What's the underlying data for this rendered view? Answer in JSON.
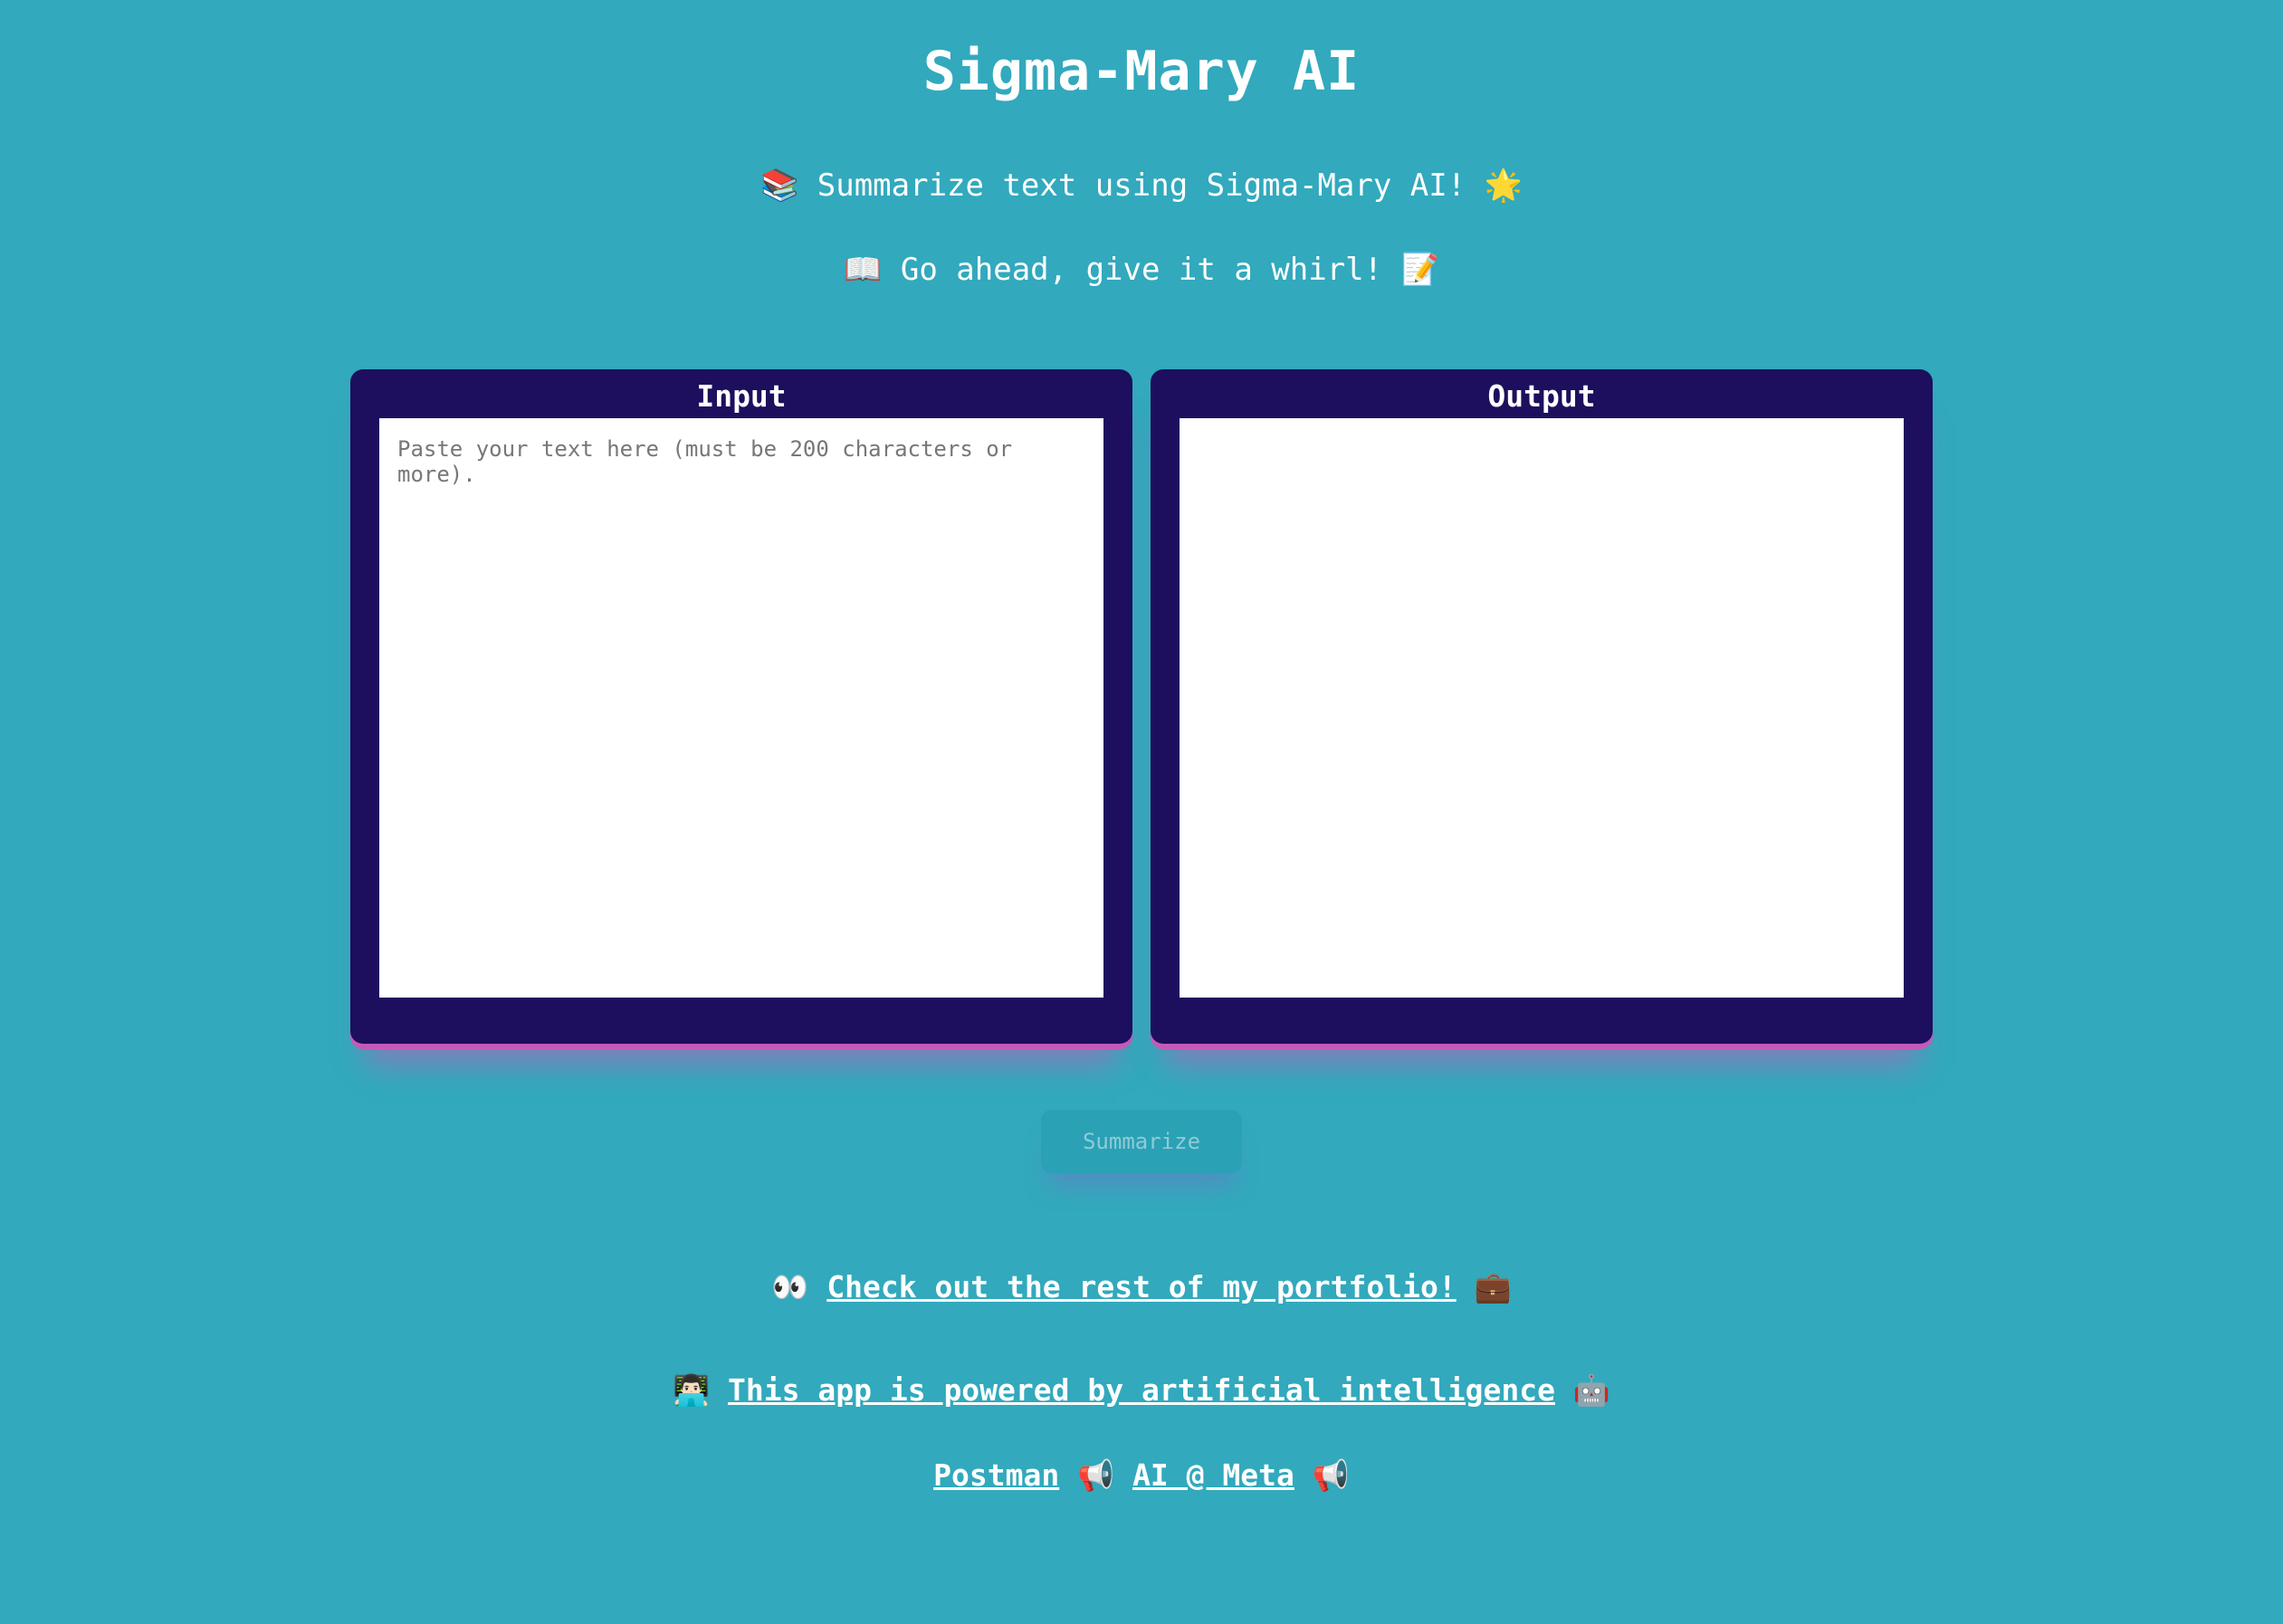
{
  "header": {
    "title": "Sigma-Mary AI",
    "tagline_one": {
      "lead_emoji": "📚",
      "text": "Summarize text using Sigma-Mary AI!",
      "trail_emoji": "🌟"
    },
    "tagline_two": {
      "lead_emoji": "📖",
      "text": "Go ahead, give it a whirl!",
      "trail_emoji": "📝"
    }
  },
  "input_panel": {
    "title": "Input",
    "placeholder": "Paste your text here (must be 200 characters or more).",
    "value": ""
  },
  "output_panel": {
    "title": "Output",
    "value": ""
  },
  "summarize_button": {
    "label": "Summarize",
    "disabled": true
  },
  "footer": {
    "portfolio": {
      "lead_emoji": "👀",
      "link_text": "Check out the rest of my portfolio!",
      "trail_emoji": "💼"
    },
    "powered": {
      "lead_emoji": "👨🏻‍💻",
      "link_text": "This app is powered by artificial intelligence",
      "trail_emoji": "🤖"
    },
    "credits": {
      "link_one": "Postman",
      "separator_emoji": "📢",
      "link_two": "AI @ Meta",
      "trail_emoji": "📢"
    }
  },
  "colors": {
    "background": "#32a9bd",
    "panel": "#1d0f5e",
    "panel_shadow": "#c45ab8",
    "button_disabled": "#2aa1b5"
  }
}
